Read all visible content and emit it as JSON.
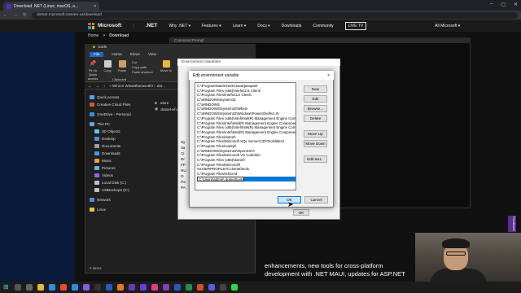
{
  "browser": {
    "tab_title": "Download .NET (Linux, macOS, a...",
    "url": "dotnet.microsoft.com/en-us/download",
    "close_tab": "×",
    "back": "←",
    "forward": "→",
    "reload": "↻"
  },
  "site": {
    "brand": "Microsoft",
    "product": ".NET",
    "nav": [
      "Why .NET ▾",
      "Features ▾",
      "Learn ▾",
      "Docs ▾",
      "Downloads",
      "Community"
    ],
    "live_tv": "LIVE TV",
    "all_microsoft": "All Microsoft ▾",
    "crumb_home": "Home",
    "crumb_sep": ">",
    "crumb_current": "Download"
  },
  "terminal": {
    "title": "Command Prompt"
  },
  "explorer": {
    "title": "tools",
    "ribbon_tabs": [
      "File",
      "Home",
      "Share",
      "View"
    ],
    "ribbon_buttons": [
      {
        "label": "Pin to Quick access",
        "icon": "pin-icon"
      },
      {
        "label": "Copy",
        "icon": "copy-icon"
      },
      {
        "label": "Paste",
        "icon": "paste-icon"
      },
      {
        "label": "Cut",
        "icon": "cut-icon"
      },
      {
        "label": "Copy path",
        "icon": "copy-path-icon"
      },
      {
        "label": "Paste shortcut",
        "icon": "paste-shortcut-icon"
      },
      {
        "label": "Move to",
        "icon": "move-icon"
      }
    ],
    "clipboard_group": "Clipboard",
    "path": "« Wiroon Wiwatthanasutthi › .dot...",
    "sidebar": [
      {
        "label": "Quick access",
        "icon": "star-icon",
        "color": "#4aa3ff"
      },
      {
        "label": "Creative Cloud Files",
        "icon": "cloud-icon",
        "color": "#e0523c"
      },
      {
        "label": "OneDrive - Personal",
        "icon": "onedrive-icon",
        "color": "#3a8de8"
      },
      {
        "label": "This PC",
        "icon": "pc-icon",
        "color": "#5aa8e8"
      },
      {
        "label": "3D Objects",
        "icon": "cube-icon",
        "color": "#5ac8e8"
      },
      {
        "label": "Desktop",
        "icon": "desktop-icon",
        "color": "#4a90d9"
      },
      {
        "label": "Documents",
        "icon": "documents-icon",
        "color": "#a0a0a0"
      },
      {
        "label": "Downloads",
        "icon": "download-icon",
        "color": "#3a9de8"
      },
      {
        "label": "Music",
        "icon": "music-icon",
        "color": "#e8a03a"
      },
      {
        "label": "Pictures",
        "icon": "pictures-icon",
        "color": "#5ab8e8"
      },
      {
        "label": "Videos",
        "icon": "videos-icon",
        "color": "#8a6ae8"
      },
      {
        "label": "Local Disk (C:)",
        "icon": "disk-icon",
        "color": "#c0c0c0"
      },
      {
        "label": "CMBackup2 (E:)",
        "icon": "disk-icon",
        "color": "#c0c0c0"
      },
      {
        "label": "Network",
        "icon": "network-icon",
        "color": "#4a90d9"
      },
      {
        "label": "Linux",
        "icon": "linux-icon",
        "color": "#e8c83a"
      }
    ],
    "files": [
      {
        "name": ".store",
        "icon": "folder-icon"
      },
      {
        "name": "dotnet-ef.e...",
        "icon": "exe-icon"
      }
    ],
    "status": "2 items"
  },
  "env_back": {
    "title": "Environment Variables",
    "ok": "OK",
    "sys_labels": [
      "Sy",
      "Va",
      "Cl",
      "Dr",
      "FP",
      "NU",
      "O",
      "Pa",
      "PA"
    ]
  },
  "dialog": {
    "title": "Edit environment variable",
    "close": "×",
    "entries": [
      "C:\\ProgramData\\Oracle\\Java\\javapath",
      "C:\\Program Files (x86)\\Intel\\iCLS Client\\",
      "C:\\Program Files\\Intel\\iCLS Client\\",
      "C:\\WINDOWS\\system32",
      "C:\\WINDOWS",
      "C:\\WINDOWS\\System32\\Wbem",
      "C:\\WINDOWS\\System32\\WindowsPowerShell\\v1.0\\",
      "C:\\Program Files (x86)\\Intel\\Intel(R) Management Engine Components\\...",
      "C:\\Program Files\\Intel\\Intel(R) Management Engine Components\\DAL",
      "C:\\Program Files (x86)\\Intel\\Intel(R) Management Engine Components\\...",
      "C:\\Program Files\\Intel\\Intel(R) Management Engine Components\\IPT",
      "C:\\Program Files\\dotnet\\",
      "C:\\Program Files\\Microsoft SQL Server\\130\\Tools\\Binn\\",
      "C:\\Program Files\\nodejs\\",
      "C:\\WINDOWS\\System32\\OpenSSH\\",
      "C:\\Program Files\\Microsoft VS Code\\bin",
      "C:\\Program Files (x86)\\dotnet\\",
      "C:\\Program Files\\Microsoft\\",
      "%USERPROFILE%\\.dotnet\\tools",
      "C:\\Program Files\\Git\\cmd"
    ],
    "editing_value": "C:\\Users\\admin\\.dotnet\\tools",
    "buttons": [
      "New",
      "Edit",
      "Browse...",
      "Delete",
      "Move Up",
      "Move Down",
      "Edit text..."
    ],
    "ok": "OK",
    "cancel": "Cancel"
  },
  "overlay": {
    "text": "enhancements, new tools for cross-platform development with .NET MAUI, updates for ASP.NET",
    "feedback": "Feedback"
  },
  "taskbar": {
    "apps": [
      {
        "icon": "search-icon",
        "color": "#555"
      },
      {
        "icon": "task-view-icon",
        "color": "#666"
      },
      {
        "icon": "explorer-icon",
        "color": "#e8b83a"
      },
      {
        "icon": "edge-icon",
        "color": "#2a8ee8"
      },
      {
        "icon": "chrome-icon",
        "color": "#e84a3a"
      },
      {
        "icon": "vscode-icon",
        "color": "#2a8ee8"
      },
      {
        "icon": "visual-studio-icon",
        "color": "#8a5ae8"
      },
      {
        "icon": "terminal-icon",
        "color": "#333"
      },
      {
        "icon": "photoshop-icon",
        "color": "#2a5ab8"
      },
      {
        "icon": "illustrator-icon",
        "color": "#e87a1a"
      },
      {
        "icon": "premiere-icon",
        "color": "#6a3ab8"
      },
      {
        "icon": "aftereffects-icon",
        "color": "#6a3ae8"
      },
      {
        "icon": "xd-icon",
        "color": "#e83a8a"
      },
      {
        "icon": "onenote-icon",
        "color": "#8a3ab8"
      },
      {
        "icon": "word-icon",
        "color": "#2a5ab8"
      },
      {
        "icon": "excel-icon",
        "color": "#2a8a4a"
      },
      {
        "icon": "powerpoint-icon",
        "color": "#d84a2a"
      },
      {
        "icon": "teams-icon",
        "color": "#5a5ae8"
      },
      {
        "icon": "obs-icon",
        "color": "#444"
      },
      {
        "icon": "spotify-icon",
        "color": "#2ad84a"
      }
    ]
  }
}
